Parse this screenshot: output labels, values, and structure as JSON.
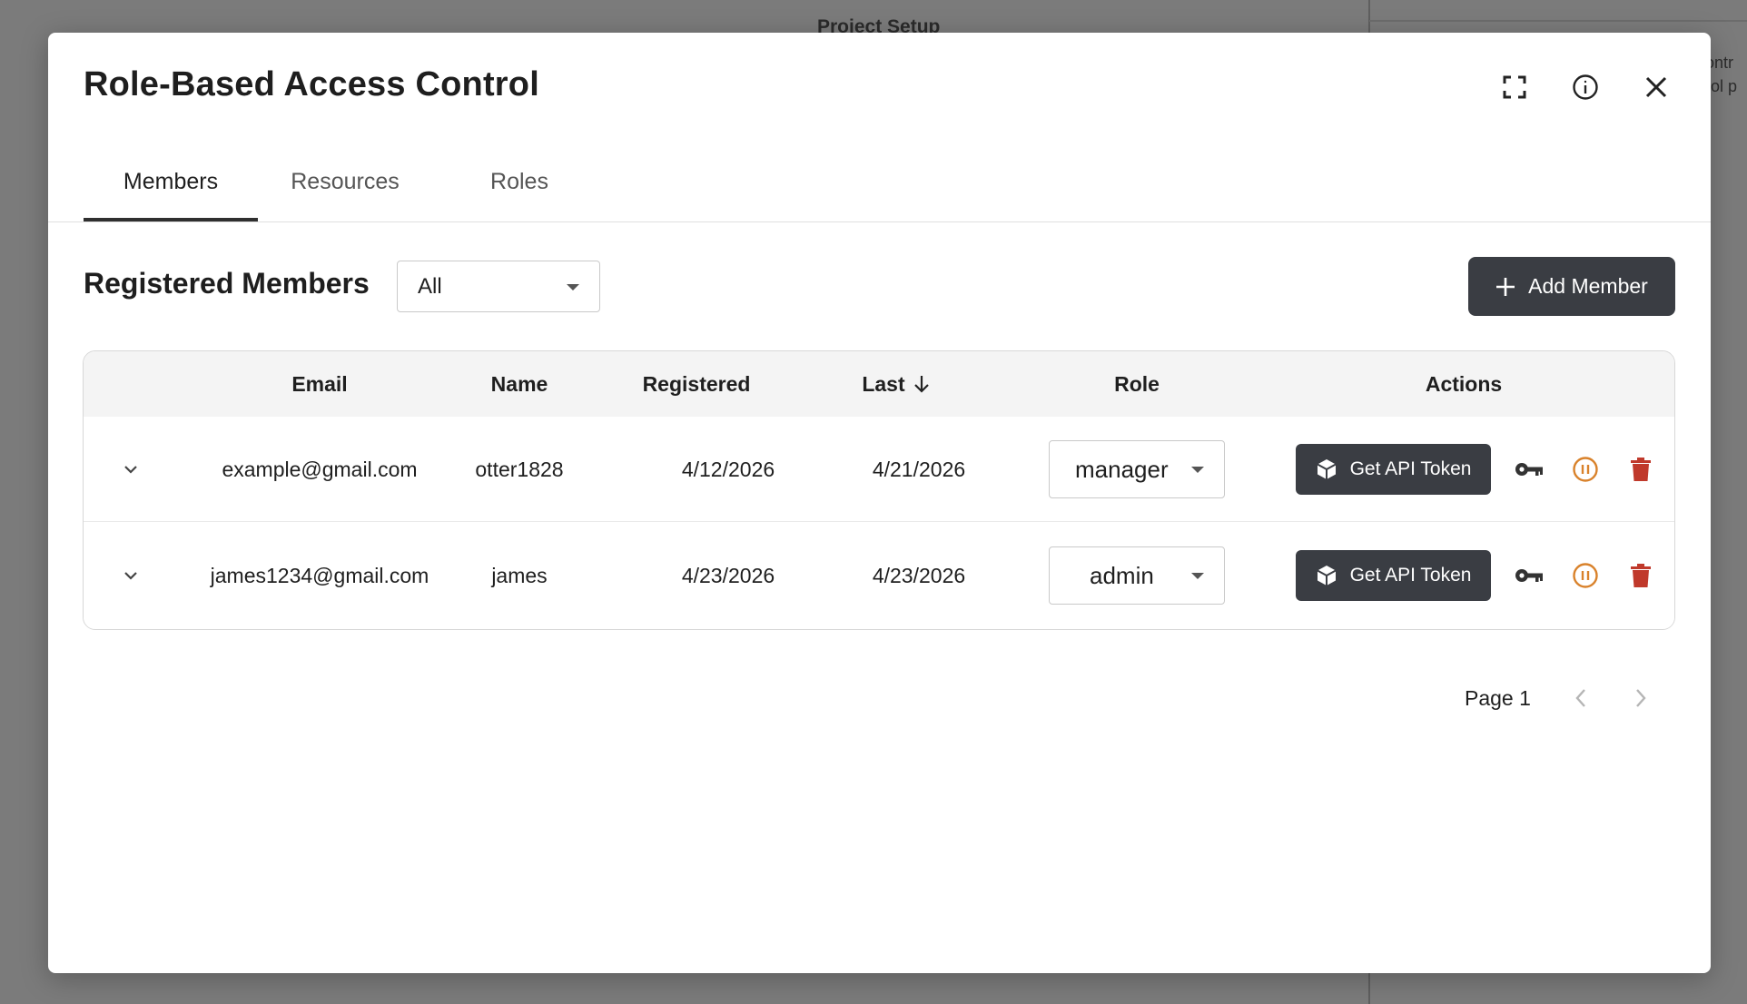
{
  "background": {
    "title": "Project Setup",
    "snippet_lines": [
      "ontr",
      "rol p"
    ]
  },
  "modal": {
    "title": "Role-Based Access Control",
    "header_icons": [
      "fullscreen-icon",
      "info-icon",
      "close-icon"
    ]
  },
  "tabs": [
    {
      "label": "Members",
      "active": true
    },
    {
      "label": "Resources",
      "active": false
    },
    {
      "label": "Roles",
      "active": false
    }
  ],
  "members": {
    "section_title": "Registered Members",
    "filter_value": "All",
    "add_button_label": "Add Member",
    "columns": {
      "email": "Email",
      "name": "Name",
      "registered": "Registered",
      "last": "Last",
      "role": "Role",
      "actions": "Actions"
    },
    "sort": {
      "column": "last",
      "direction": "descending"
    },
    "rows": [
      {
        "email": "example@gmail.com",
        "name": "otter1828",
        "registered": "4/12/2026",
        "last": "4/21/2026",
        "role": "manager",
        "token_button": "Get API Token"
      },
      {
        "email": "james1234@gmail.com",
        "name": "james",
        "registered": "4/23/2026",
        "last": "4/23/2026",
        "role": "admin",
        "token_button": "Get API Token"
      }
    ]
  },
  "pagination": {
    "label": "Page 1"
  },
  "colors": {
    "primary_button": "#3a3d43",
    "pause_icon": "#d9822b",
    "delete_icon": "#c0392b"
  }
}
